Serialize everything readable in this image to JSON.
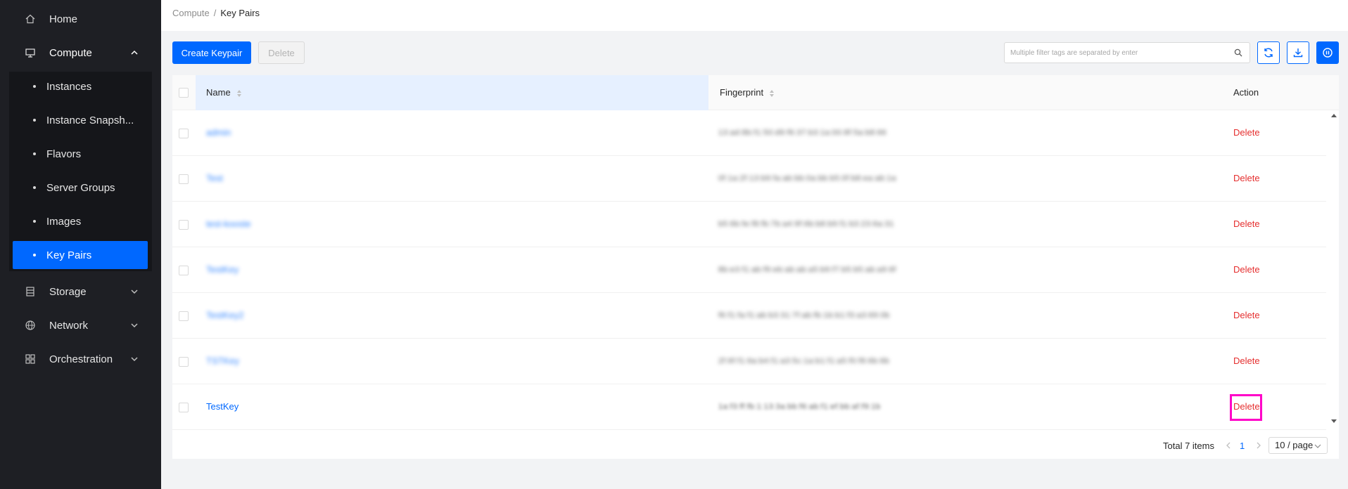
{
  "sidebar": {
    "home": "Home",
    "compute": "Compute",
    "compute_items": [
      "Instances",
      "Instance Snapsh...",
      "Flavors",
      "Server Groups",
      "Images",
      "Key Pairs"
    ],
    "storage": "Storage",
    "network": "Network",
    "orchestration": "Orchestration"
  },
  "breadcrumb": {
    "parent": "Compute",
    "separator": "/",
    "current": "Key Pairs"
  },
  "toolbar": {
    "create_label": "Create Keypair",
    "delete_label": "Delete",
    "search_placeholder": "Multiple filter tags are separated by enter"
  },
  "table": {
    "columns": {
      "name": "Name",
      "fingerprint": "Fingerprint",
      "action": "Action"
    },
    "rows": [
      {
        "name": "admin",
        "fingerprint": "13:ad:8b:f1:50:d9:f6:37:b3:1a:00:8f:5a:b8:66",
        "action": "Delete"
      },
      {
        "name": "Test",
        "fingerprint": "0f:1a:2f:13:b9:fa:ab:bb:0a:bb:b5:0f:b8:ea:ab:1a",
        "action": "Delete"
      },
      {
        "name": "test-kooste",
        "fingerprint": "b5:6b:fe:f8:fb:7b:a4:9f:6b:b8:b9:f1:b3:23:6a:31",
        "action": "Delete"
      },
      {
        "name": "TestKey",
        "fingerprint": "8b:e3:f1:ab:f9:eb:ab:ab:a5:b9:f7:b5:b5:ab:a9:6f",
        "action": "Delete"
      },
      {
        "name": "TestKey2",
        "fingerprint": "f6:f1:fa:f1:ab:b3:31:7f:ab:fb:1b:b1:f3:a3:69:0b",
        "action": "Delete"
      },
      {
        "name": "TSTKey",
        "fingerprint": "2f:6f:f1:6a:b4:f1:a3:5c:1a:b1:f1:a5:f0:f8:6b:6b",
        "action": "Delete"
      },
      {
        "name": "TestKey",
        "fingerprint": "1a:f3:ff:fb:1:13:3a:bb:f6:ab:f1:ef:bb:af:f9:1b",
        "action": "Delete"
      }
    ]
  },
  "pagination": {
    "total": "Total 7 items",
    "current_page": "1",
    "page_size": "10 / page"
  },
  "colors": {
    "primary": "#0068ff",
    "danger": "#e52e2e",
    "sidebar_bg": "#1e1f24",
    "highlight": "#ff00c8"
  }
}
